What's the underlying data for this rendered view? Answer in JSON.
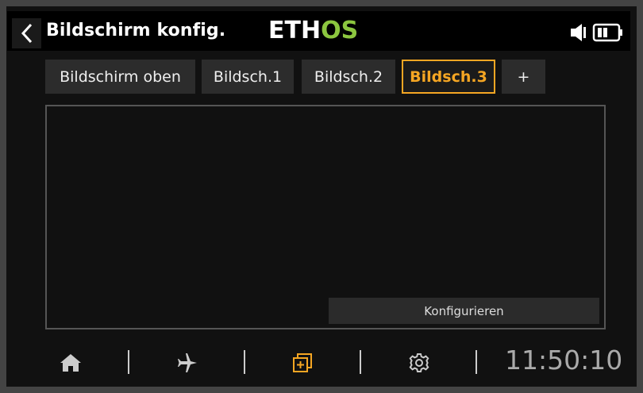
{
  "header": {
    "title": "Bildschirm konfig.",
    "logo_primary": "ETH",
    "logo_accent": "OS"
  },
  "tabs": [
    {
      "label": "Bildschirm oben",
      "active": false
    },
    {
      "label": "Bildsch.1",
      "active": false
    },
    {
      "label": "Bildsch.2",
      "active": false
    },
    {
      "label": "Bildsch.3",
      "active": true
    },
    {
      "label": "+",
      "active": false
    }
  ],
  "main": {
    "configure_label": "Konfigurieren"
  },
  "nav": {
    "items": [
      "home-icon",
      "airplane-icon",
      "screens-icon",
      "gear-icon"
    ],
    "active": "screens-icon",
    "clock": "11:50:10"
  },
  "colors": {
    "accent": "#f5a623",
    "logo_green": "#8cc63f",
    "background": "#111111"
  }
}
